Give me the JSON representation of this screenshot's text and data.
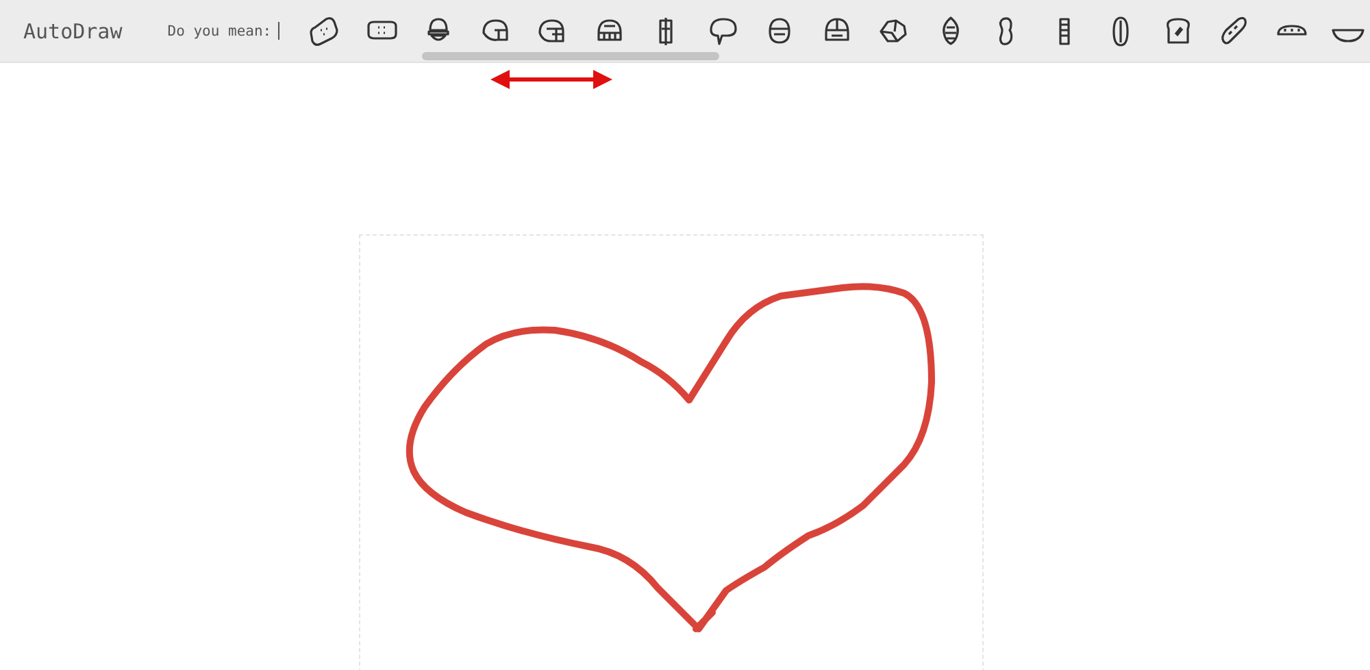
{
  "toolbar": {
    "app_title": "AutoDraw",
    "suggestions_prompt": "Do you mean:"
  }
}
